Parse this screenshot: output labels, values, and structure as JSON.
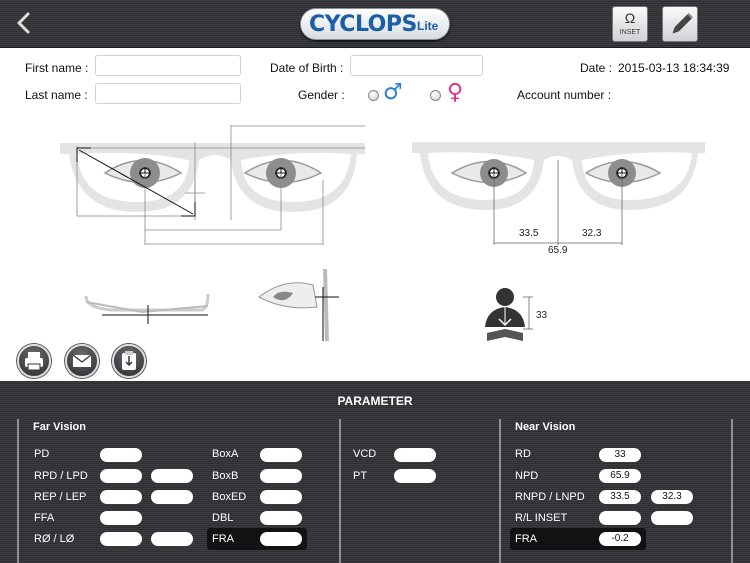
{
  "header": {
    "logo_text": "CYCLOPS",
    "logo_suffix": "Lite",
    "inset_label": "INSET",
    "inset_symbol": "Ω"
  },
  "form": {
    "first_name_label": "First name :",
    "first_name_value": "",
    "last_name_label": "Last name :",
    "last_name_value": "",
    "dob_label": "Date of Birth :",
    "dob_value": "",
    "gender_label": "Gender :",
    "gender_male_symbol": "♂",
    "gender_female_symbol": "♀",
    "date_label": "Date :",
    "date_value": "2015-03-13 18:34:39",
    "account_label": "Account number :",
    "account_value": ""
  },
  "measure": {
    "left_pd": "33.5",
    "right_pd": "32.3",
    "total_pd": "65.9",
    "reading_distance": "33"
  },
  "panel": {
    "title": "PARAMETER",
    "far_vision": {
      "title": "Far Vision",
      "rows": [
        {
          "label": "PD",
          "values": [
            ""
          ]
        },
        {
          "label": "RPD / LPD",
          "values": [
            "",
            ""
          ]
        },
        {
          "label": "REP / LEP",
          "values": [
            "",
            ""
          ]
        },
        {
          "label": "FFA",
          "values": [
            ""
          ]
        },
        {
          "label": "RØ / LØ",
          "values": [
            "",
            ""
          ]
        }
      ],
      "box_rows": [
        {
          "label": "BoxA",
          "value": ""
        },
        {
          "label": "BoxB",
          "value": ""
        },
        {
          "label": "BoxED",
          "value": ""
        },
        {
          "label": "DBL",
          "value": ""
        },
        {
          "label": "FRA",
          "value": ""
        }
      ]
    },
    "middle": {
      "rows": [
        {
          "label": "VCD",
          "value": ""
        },
        {
          "label": "PT",
          "value": ""
        }
      ]
    },
    "near_vision": {
      "title": "Near Vision",
      "rows": [
        {
          "label": "RD",
          "values": [
            "33"
          ]
        },
        {
          "label": "NPD",
          "values": [
            "65.9"
          ]
        },
        {
          "label": "RNPD / LNPD",
          "values": [
            "33.5",
            "32.3"
          ]
        },
        {
          "label": "R/L INSET",
          "values": [
            "",
            ""
          ]
        },
        {
          "label": "FRA",
          "values": [
            "-0.2"
          ]
        }
      ]
    }
  },
  "colors": {
    "brand_blue": "#1b5fa8",
    "male_blue": "#2a7fd0",
    "female_pink": "#e0308a"
  },
  "icons": [
    "back-chevron-icon",
    "omega-icon",
    "pencil-icon",
    "print-icon",
    "mail-icon",
    "clipboard-export-icon",
    "person-reading-icon"
  ]
}
